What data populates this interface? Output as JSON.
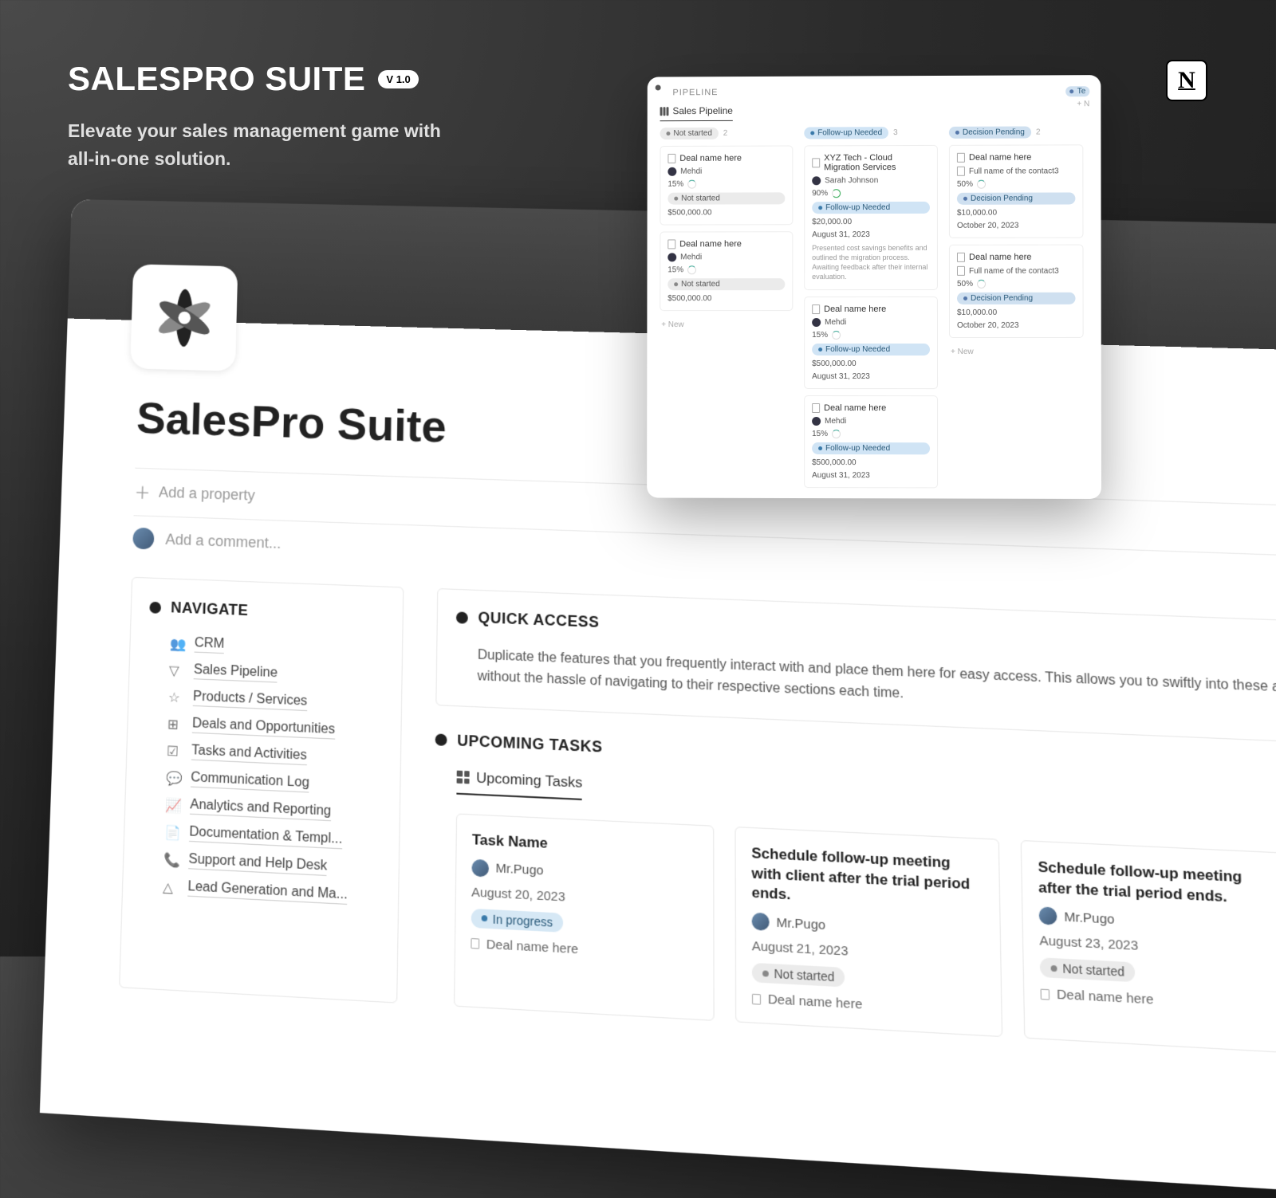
{
  "hero": {
    "title": "SALESPRO SUITE",
    "version": "V 1.0",
    "subtitle_l1": "Elevate your sales management game with",
    "subtitle_l2": "all-in-one solution."
  },
  "notion_glyph": "N",
  "main": {
    "title": "SalesPro Suite",
    "add_property": "Add a property",
    "add_comment": "Add a comment...",
    "navigate_label": "NAVIGATE",
    "nav_items": [
      "CRM",
      "Sales Pipeline",
      "Products / Services",
      "Deals and Opportunities",
      "Tasks and Activities",
      "Communication Log",
      "Analytics and Reporting",
      "Documentation & Templ...",
      "Support and Help Desk",
      "Lead Generation and Ma..."
    ],
    "quick_access": {
      "title": "QUICK ACCESS",
      "desc": "Duplicate the features that you frequently interact with and place them here for easy access. This allows you to swiftly into these aspects without the hassle of navigating to their respective sections each time."
    },
    "upcoming": {
      "title": "UPCOMING TASKS",
      "tab": "Upcoming Tasks",
      "cards": [
        {
          "title": "Task Name",
          "person": "Mr.Pugo",
          "date": "August 20, 2023",
          "status": "In progress",
          "status_class": "progress",
          "deal": "Deal name here"
        },
        {
          "title": "Schedule follow-up meeting with client after the trial period ends.",
          "person": "Mr.Pugo",
          "date": "August 21, 2023",
          "status": "Not started",
          "status_class": "notstart",
          "deal": "Deal name here"
        },
        {
          "title": "Schedule follow-up meeting after the trial period ends.",
          "person": "Mr.Pugo",
          "date": "August 23, 2023",
          "status": "Not started",
          "status_class": "notstart",
          "deal": "Deal name here"
        }
      ]
    }
  },
  "overlay": {
    "breadcrumb": "PIPELINE",
    "tab": "Sales Pipeline",
    "te_label": "Te",
    "new_label": "+ N",
    "new_full": "+  New",
    "columns": [
      {
        "label": "Not started",
        "tag_class": "grey",
        "count": "2",
        "cards": [
          {
            "title": "Deal name here",
            "person": "Mehdi",
            "percent": "15%",
            "status": "Not started",
            "status_class": "grey",
            "amount": "$500,000.00"
          },
          {
            "title": "Deal name here",
            "person": "Mehdi",
            "percent": "15%",
            "status": "Not started",
            "status_class": "grey",
            "amount": "$500,000.00"
          }
        ]
      },
      {
        "label": "Follow-up Needed",
        "tag_class": "blue",
        "count": "3",
        "cards": [
          {
            "title": "XYZ Tech - Cloud Migration Services",
            "person": "Sarah Johnson",
            "percent": "90%",
            "ring": "g",
            "status": "Follow-up Needed",
            "status_class": "blue",
            "amount": "$20,000.00",
            "date": "August 31, 2023",
            "note": "Presented cost savings benefits and outlined the migration process. Awaiting feedback after their internal evaluation."
          },
          {
            "title": "Deal name here",
            "person": "Mehdi",
            "percent": "15%",
            "status": "Follow-up Needed",
            "status_class": "blue",
            "amount": "$500,000.00",
            "date": "August 31, 2023"
          },
          {
            "title": "Deal name here",
            "person": "Mehdi",
            "percent": "15%",
            "status": "Follow-up Needed",
            "status_class": "blue",
            "amount": "$500,000.00",
            "date": "August 31, 2023"
          }
        ]
      },
      {
        "label": "Decision Pending",
        "tag_class": "blue2",
        "count": "2",
        "cards": [
          {
            "title": "Deal name here",
            "sub": "Full name of the contact3",
            "percent": "50%",
            "status": "Decision Pending",
            "status_class": "blue2",
            "amount": "$10,000.00",
            "date": "October 20, 2023"
          },
          {
            "title": "Deal name here",
            "sub": "Full name of the contact3",
            "percent": "50%",
            "status": "Decision Pending",
            "status_class": "blue2",
            "amount": "$10,000.00",
            "date": "October 20, 2023"
          }
        ]
      }
    ]
  }
}
